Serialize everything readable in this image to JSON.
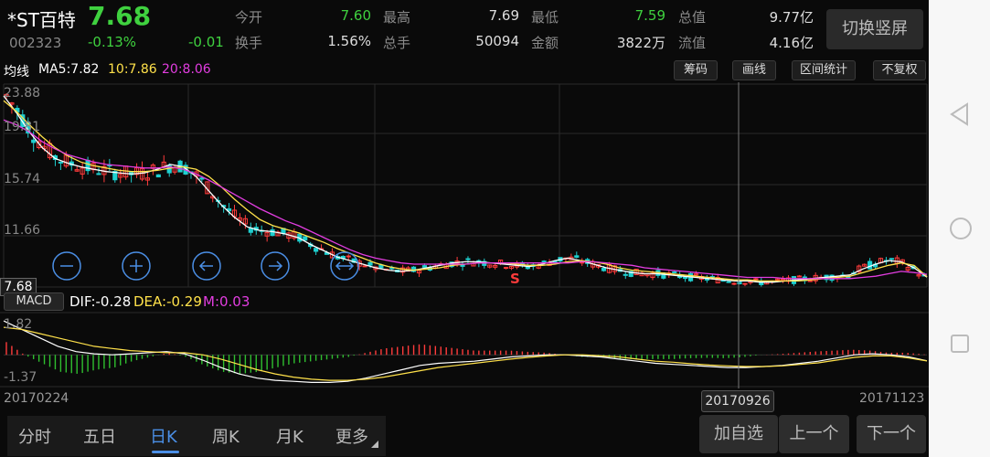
{
  "stock": {
    "name": "*ST百特",
    "code": "002323",
    "price": "7.68",
    "change_pct": "-0.13%",
    "change": "-0.01"
  },
  "quote": [
    {
      "label": "今开",
      "value": "7.60",
      "color": "green"
    },
    {
      "label": "最高",
      "value": "7.69",
      "color": "normal"
    },
    {
      "label": "最低",
      "value": "7.59",
      "color": "green"
    },
    {
      "label": "总值",
      "value": "9.77亿",
      "color": "normal"
    },
    {
      "label": "换手",
      "value": "1.56%",
      "color": "normal"
    },
    {
      "label": "总手",
      "value": "50094",
      "color": "normal"
    },
    {
      "label": "金额",
      "value": "3822万",
      "color": "normal"
    },
    {
      "label": "流值",
      "value": "4.16亿",
      "color": "normal"
    }
  ],
  "header_button": "切换竖屏",
  "ma": {
    "title": "均线",
    "ma5": "MA5:7.82",
    "ma10": "10:7.86",
    "ma20": "20:8.06"
  },
  "tools": [
    "筹码",
    "画线",
    "区间统计",
    "不复权"
  ],
  "price_axis": [
    "23.88",
    "19.81",
    "15.74",
    "11.66"
  ],
  "current_price_tag": "7.68",
  "signal_label": "S",
  "macd": {
    "tag": "MACD",
    "dif": "DIF:-0.28",
    "dea": "DEA:-0.29",
    "m": "M:0.03",
    "axis_top": "1.82",
    "axis_bottom": "-1.37"
  },
  "dates": {
    "start": "20170224",
    "cursor": "20170926",
    "end": "20171123"
  },
  "tabs": [
    "分时",
    "五日",
    "日K",
    "周K",
    "月K",
    "更多"
  ],
  "active_tab": "日K",
  "actions": [
    "加自选",
    "上一个",
    "下一个"
  ],
  "colors": {
    "up": "#ff3b3b",
    "down": "#1fd0d0",
    "ma5": "#ffffff",
    "ma10": "#ffe14a",
    "ma20": "#e23de0",
    "accent": "#4b8fe6",
    "price_green": "#3fd13f"
  },
  "chart_data": {
    "type": "candlestick",
    "series": [
      {
        "name": "MA5",
        "values": [
          22.9,
          21.5,
          19.9,
          18.6,
          17.7,
          17.3,
          17.0,
          16.8,
          16.6,
          16.5,
          16.4,
          16.5,
          16.8,
          17.2,
          17.0,
          16.2,
          15.0,
          13.8,
          12.8,
          12.0,
          11.7,
          11.6,
          11.4,
          11.1,
          10.5,
          10.0,
          9.5,
          9.2,
          8.9,
          8.6,
          8.4,
          8.3,
          8.4,
          8.6,
          8.8,
          9.0,
          9.1,
          9.1,
          9.0,
          8.9,
          8.8,
          8.7,
          8.9,
          9.2,
          9.4,
          9.2,
          8.9,
          8.6,
          8.4,
          8.2,
          8.1,
          8.1,
          8.0,
          7.9,
          7.8,
          7.7,
          7.6,
          7.5,
          7.5,
          7.4,
          7.4,
          7.5,
          7.6,
          7.7,
          7.8,
          7.9,
          8.0,
          8.5,
          8.9,
          9.2,
          9.1,
          8.6,
          7.82
        ]
      },
      {
        "name": "MA10",
        "values": [
          22.5,
          21.6,
          20.5,
          19.5,
          18.6,
          17.9,
          17.4,
          17.1,
          16.9,
          16.7,
          16.6,
          16.6,
          16.7,
          16.9,
          17.0,
          16.8,
          16.2,
          15.3,
          14.3,
          13.4,
          12.6,
          12.1,
          11.8,
          11.5,
          11.1,
          10.7,
          10.2,
          9.8,
          9.4,
          9.0,
          8.7,
          8.5,
          8.4,
          8.5,
          8.6,
          8.8,
          8.9,
          9.0,
          9.0,
          9.0,
          8.9,
          8.8,
          8.8,
          8.9,
          9.1,
          9.2,
          9.1,
          8.9,
          8.6,
          8.4,
          8.3,
          8.2,
          8.1,
          8.0,
          7.9,
          7.8,
          7.7,
          7.6,
          7.6,
          7.5,
          7.5,
          7.5,
          7.5,
          7.6,
          7.7,
          7.8,
          7.9,
          8.2,
          8.5,
          8.8,
          9.0,
          8.8,
          7.86
        ]
      },
      {
        "name": "MA20",
        "values": [
          20.9,
          20.5,
          19.9,
          19.1,
          18.5,
          18.0,
          17.7,
          17.4,
          17.2,
          17.1,
          17.0,
          16.9,
          16.9,
          17.0,
          16.8,
          16.4,
          15.9,
          15.3,
          14.7,
          14.1,
          13.5,
          13.0,
          12.5,
          12.1,
          11.6,
          11.1,
          10.6,
          10.1,
          9.7,
          9.4,
          9.2,
          9.0,
          8.9,
          8.9,
          8.9,
          8.9,
          8.9,
          9.0,
          9.0,
          9.0,
          9.0,
          9.0,
          9.0,
          9.0,
          9.0,
          9.1,
          9.1,
          9.0,
          8.9,
          8.8,
          8.6,
          8.5,
          8.4,
          8.3,
          8.2,
          8.1,
          8.0,
          7.9,
          7.8,
          7.8,
          7.8,
          7.7,
          7.7,
          7.7,
          7.7,
          7.7,
          7.7,
          7.8,
          7.9,
          8.1,
          8.3,
          8.2,
          8.06
        ]
      }
    ],
    "ylim": [
      7.0,
      23.88
    ],
    "macd": {
      "dif": [
        1.6,
        1.2,
        0.8,
        0.4,
        0.15,
        0.05,
        0.0,
        0.05,
        0.1,
        0.15,
        0.05,
        -0.25,
        -0.6,
        -0.9,
        -1.1,
        -1.2,
        -1.25,
        -1.3,
        -1.3,
        -1.25,
        -1.1,
        -0.9,
        -0.7,
        -0.5,
        -0.4,
        -0.35,
        -0.3,
        -0.2,
        -0.1,
        -0.05,
        0.0,
        0.0,
        -0.05,
        -0.1,
        -0.2,
        -0.3,
        -0.4,
        -0.45,
        -0.5,
        -0.55,
        -0.6,
        -0.6,
        -0.55,
        -0.5,
        -0.4,
        -0.3,
        -0.15,
        0.0,
        0.05,
        0.0,
        -0.1,
        -0.28
      ],
      "dea": [
        1.3,
        1.2,
        1.0,
        0.8,
        0.6,
        0.4,
        0.3,
        0.2,
        0.15,
        0.1,
        0.1,
        0.0,
        -0.2,
        -0.45,
        -0.7,
        -0.9,
        -1.05,
        -1.15,
        -1.2,
        -1.2,
        -1.15,
        -1.05,
        -0.9,
        -0.75,
        -0.6,
        -0.5,
        -0.4,
        -0.3,
        -0.2,
        -0.12,
        -0.05,
        0.0,
        0.0,
        -0.05,
        -0.1,
        -0.2,
        -0.3,
        -0.35,
        -0.42,
        -0.48,
        -0.52,
        -0.55,
        -0.55,
        -0.52,
        -0.45,
        -0.38,
        -0.25,
        -0.12,
        -0.05,
        -0.05,
        -0.15,
        -0.29
      ],
      "ylim": [
        -1.37,
        1.82
      ]
    }
  }
}
